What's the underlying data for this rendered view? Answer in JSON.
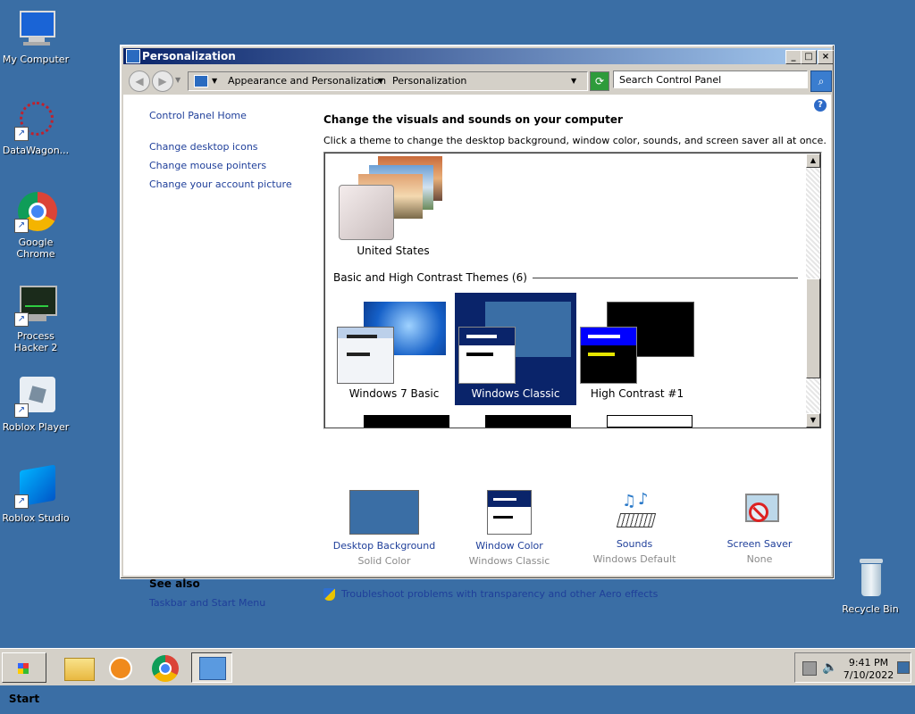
{
  "desktop": {
    "icons": [
      {
        "label": "My Computer"
      },
      {
        "label": "DataWagon..."
      },
      {
        "label": "Google Chrome"
      },
      {
        "label": "Process Hacker 2"
      },
      {
        "label": "Roblox Player"
      },
      {
        "label": "Roblox Studio"
      },
      {
        "label": "Recycle Bin"
      }
    ]
  },
  "window": {
    "title": "Personalization",
    "buttons": {
      "minimize": "_",
      "maximize": "□",
      "close": "×"
    },
    "address": {
      "crumb1": "Appearance and Personalization",
      "crumb2": "Personalization",
      "search_placeholder": "Search Control Panel"
    },
    "sidebar": {
      "home": "Control Panel Home",
      "links": [
        "Change desktop icons",
        "Change mouse pointers",
        "Change your account picture"
      ],
      "see_also_title": "See also",
      "see_also_link": "Taskbar and Start Menu"
    },
    "main": {
      "heading": "Change the visuals and sounds on your computer",
      "subtext": "Click a theme to change the desktop background, window color, sounds, and screen saver all at once.",
      "themes": {
        "top_theme": "United States",
        "group_label": "Basic and High Contrast Themes (6)",
        "basic": [
          "Windows 7 Basic",
          "Windows Classic",
          "High Contrast #1"
        ],
        "selected": "Windows Classic"
      },
      "settings": [
        {
          "name": "Desktop Background",
          "value": "Solid Color"
        },
        {
          "name": "Window Color",
          "value": "Windows Classic"
        },
        {
          "name": "Sounds",
          "value": "Windows Default"
        },
        {
          "name": "Screen Saver",
          "value": "None"
        }
      ],
      "troubleshoot": "Troubleshoot problems with transparency and other Aero effects"
    }
  },
  "taskbar": {
    "start_label": "Start",
    "time": "9:41 PM",
    "date": "7/10/2022"
  },
  "colors": {
    "desktop": "#3a6ea5",
    "link": "#1f3f9a",
    "selection": "#0a246a"
  }
}
